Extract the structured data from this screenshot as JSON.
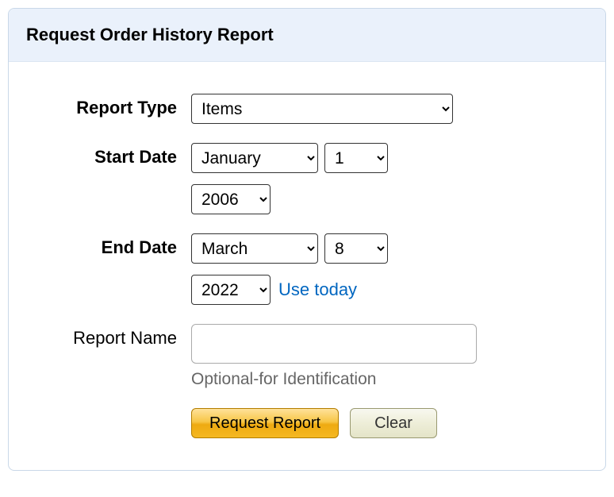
{
  "header": {
    "title": "Request Order History Report"
  },
  "form": {
    "reportType": {
      "label": "Report Type",
      "value": "Items"
    },
    "startDate": {
      "label": "Start Date",
      "month": "January",
      "day": "1",
      "year": "2006"
    },
    "endDate": {
      "label": "End Date",
      "month": "March",
      "day": "8",
      "year": "2022",
      "useTodayLink": "Use today"
    },
    "reportName": {
      "label": "Report Name",
      "value": "",
      "hint": "Optional-for Identification"
    },
    "buttons": {
      "submit": "Request Report",
      "clear": "Clear"
    }
  }
}
